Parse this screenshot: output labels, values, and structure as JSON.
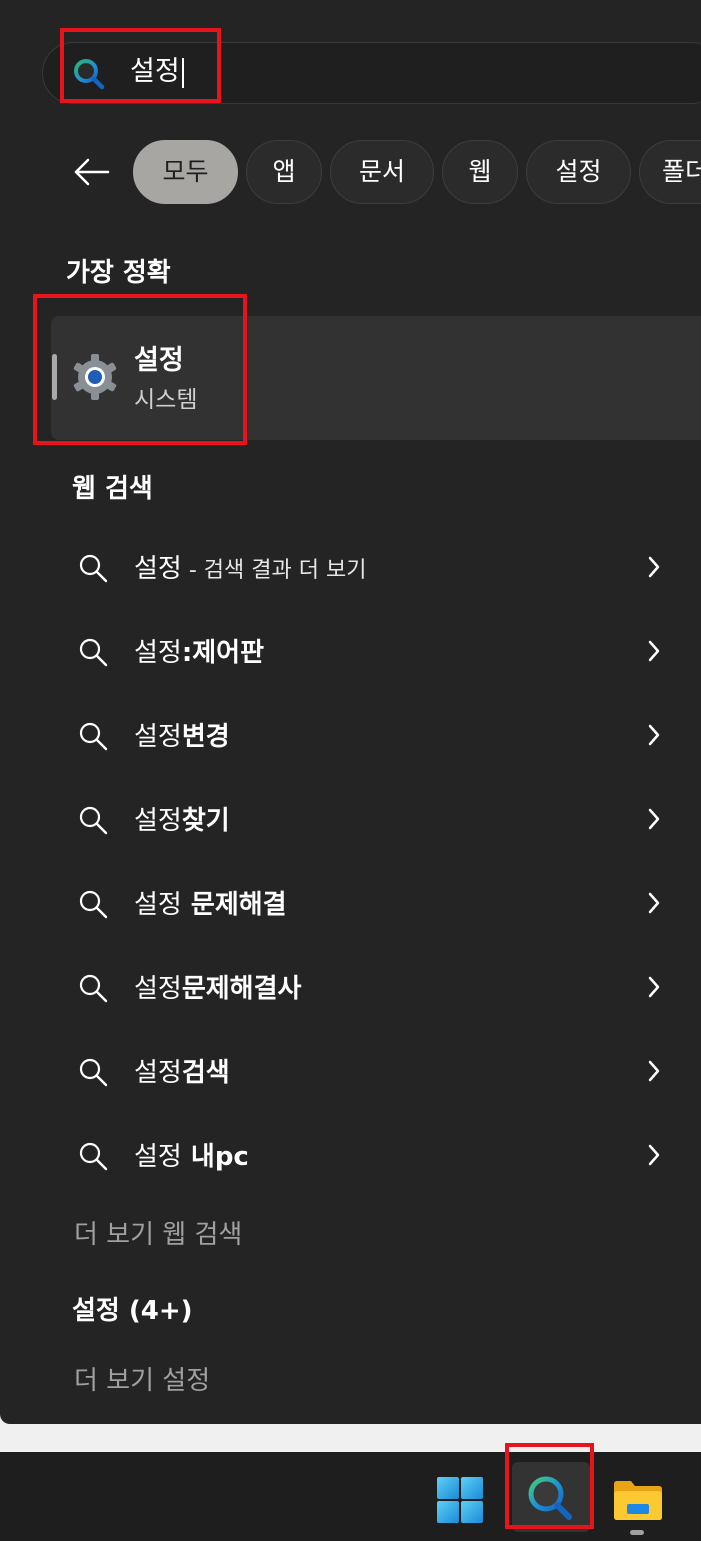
{
  "search": {
    "query": "설정"
  },
  "filters": {
    "chips": [
      {
        "label": "모두"
      },
      {
        "label": "앱"
      },
      {
        "label": "문서"
      },
      {
        "label": "웹"
      },
      {
        "label": "설정"
      },
      {
        "label": "폴더"
      }
    ]
  },
  "best_match": {
    "heading": "가장 정확",
    "title": "설정",
    "subtitle": "시스템",
    "icon": "gear-icon"
  },
  "web_search": {
    "heading": "웹 검색",
    "results": [
      {
        "prefix": "설정",
        "suffix": " - 검색 결과 더 보기"
      },
      {
        "prefix": "설정",
        "suffix": ":제어판"
      },
      {
        "prefix": "설정",
        "suffix": "변경"
      },
      {
        "prefix": "설정",
        "suffix": "찾기"
      },
      {
        "prefix": "설정",
        "suffix": " 문제해결"
      },
      {
        "prefix": "설정",
        "suffix": "문제해결사"
      },
      {
        "prefix": "설정",
        "suffix": "검색"
      },
      {
        "prefix": "설정",
        "suffix": " 내pc"
      }
    ],
    "more_label": "더 보기 웹 검색"
  },
  "settings_section": {
    "heading": "설정 (4+)",
    "more_label": "더 보기 설정"
  },
  "colors": {
    "panel": "#242424",
    "highlight": "#e8141b",
    "active_chip": "#a8a6a3"
  }
}
